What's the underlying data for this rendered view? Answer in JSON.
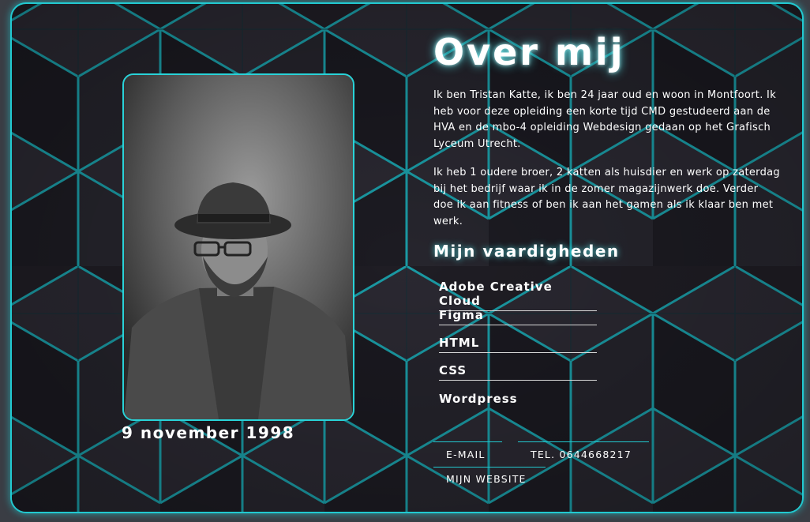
{
  "about": {
    "title": "Over mij",
    "paragraph_1": "Ik ben Tristan Katte, ik ben 24 jaar oud en woon in Montfoort. Ik heb voor deze opleiding een korte tijd CMD gestudeerd aan de HVA en de mbo-4 opleiding Webdesign gedaan op het Grafisch Lyceum Utrecht.",
    "paragraph_2": "Ik heb 1 oudere broer, 2 katten als huisdier en werk op zaterdag bij het bedrijf waar ik in de zomer magazijnwerk doe. Verder doe ik aan fitness of ben ik aan het gamen als ik klaar ben met werk."
  },
  "profile": {
    "birth_date": "9 november 1998"
  },
  "skills": {
    "heading": "Mijn vaardigheden",
    "items": [
      "Adobe Creative Cloud",
      "Figma",
      "HTML",
      "CSS",
      "Wordpress"
    ]
  },
  "contact": {
    "email_label": "E-MAIL",
    "phone_label": "TEL. 0644668217",
    "website_label": "MIJN WEBSITE"
  },
  "colors": {
    "accent": "#22c9d0",
    "background": "#1f1d24",
    "text": "#ffffff"
  }
}
